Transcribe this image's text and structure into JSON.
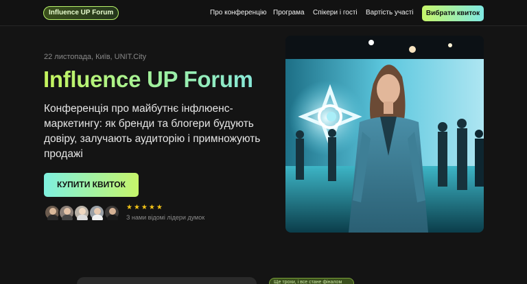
{
  "header": {
    "logo": "Influence UP Forum",
    "nav": [
      "Про конференцію",
      "Програма",
      "Спікери і гості",
      "Вартість участі"
    ],
    "cta": "Вибрати квиток"
  },
  "hero": {
    "date_location": "22 листопада, Київ, UNIT.City",
    "title": "Influence UP Forum",
    "description": "Конференція про майбутнє інфлюенс-маркетингу: як бренди та блогери будують довіру, залучають аудиторію і примножують продажі",
    "buy_label": "КУПИТИ КВИТОК",
    "rating_stars": "★★★★★",
    "rating": 5,
    "social_proof": "З нами відомі лідери думок"
  },
  "bottom": {
    "pill_text": "Ще трохи, і все стане фіналом"
  },
  "colors": {
    "background": "#141414",
    "accent_lime": "#c6f56a",
    "accent_cyan": "#7fe9e3",
    "star": "#f5c518"
  }
}
